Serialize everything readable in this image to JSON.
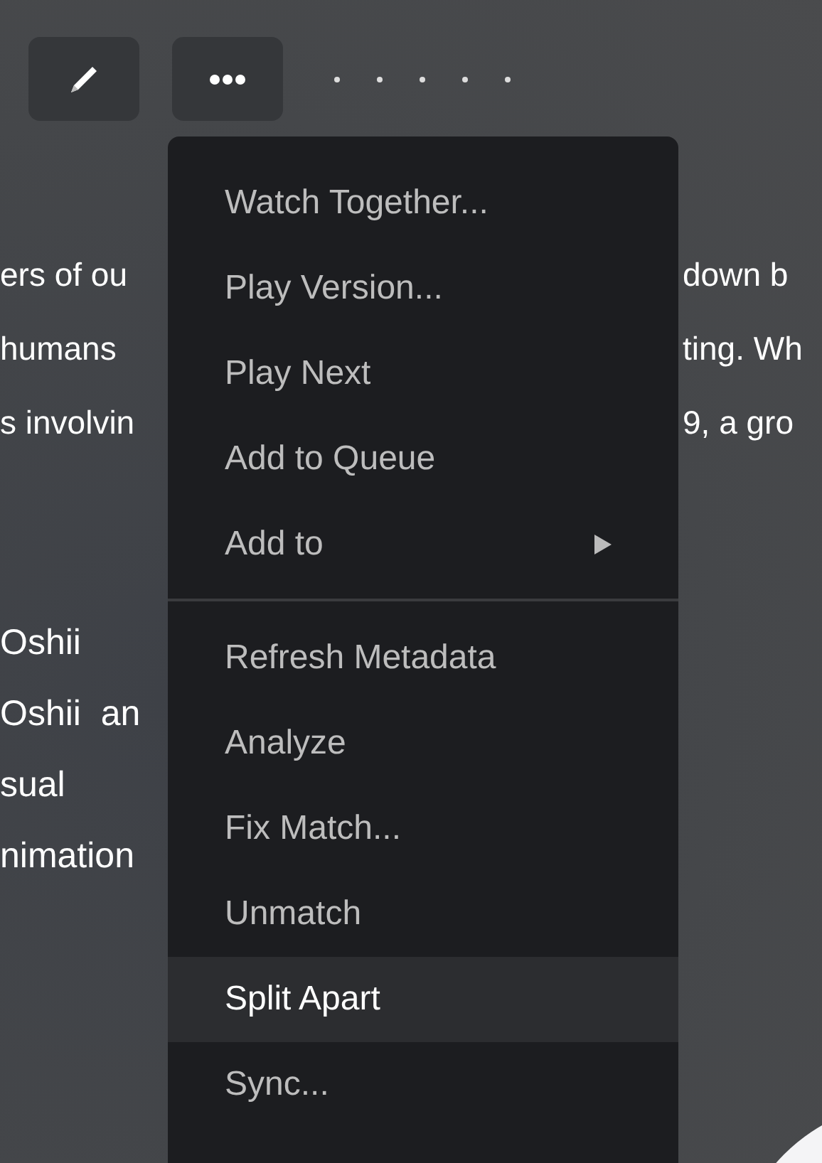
{
  "toolbar": {
    "buttons": [
      {
        "kind": "edit"
      },
      {
        "kind": "more"
      }
    ]
  },
  "description": {
    "lines": [
      {
        "left": "ers of ou",
        "right": "down b"
      },
      {
        "left": "humans",
        "right": "ting. Wh"
      },
      {
        "left": "s involvin",
        "right": "9, a gro"
      }
    ]
  },
  "credits": [
    "Oshii",
    "Oshii  an",
    "sual",
    "nimation"
  ],
  "menu": {
    "groups": [
      [
        {
          "label": "Watch Together...",
          "submenu": false,
          "selected": false
        },
        {
          "label": "Play Version...",
          "submenu": false,
          "selected": false
        },
        {
          "label": "Play Next",
          "submenu": false,
          "selected": false
        },
        {
          "label": "Add to Queue",
          "submenu": false,
          "selected": false
        },
        {
          "label": "Add to",
          "submenu": true,
          "selected": false
        }
      ],
      [
        {
          "label": "Refresh Metadata",
          "submenu": false,
          "selected": false
        },
        {
          "label": "Analyze",
          "submenu": false,
          "selected": false
        },
        {
          "label": "Fix Match...",
          "submenu": false,
          "selected": false
        },
        {
          "label": "Unmatch",
          "submenu": false,
          "selected": false
        },
        {
          "label": "Split Apart",
          "submenu": false,
          "selected": true
        },
        {
          "label": "Sync...",
          "submenu": false,
          "selected": false
        }
      ]
    ]
  }
}
